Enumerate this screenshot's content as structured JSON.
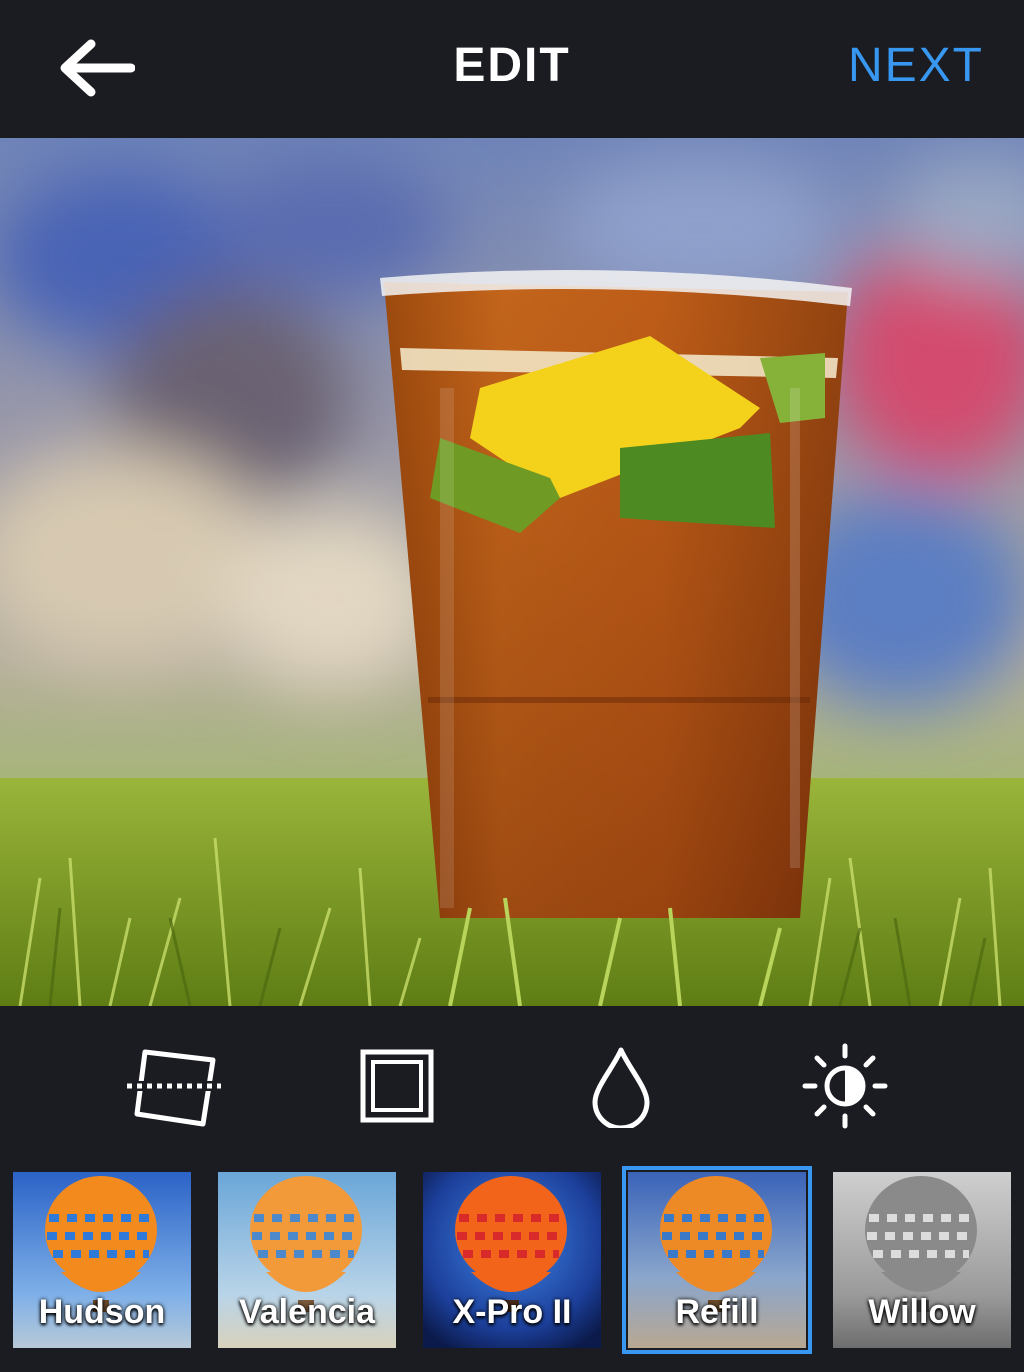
{
  "header": {
    "title": "EDIT",
    "next_label": "NEXT",
    "back_icon": "arrow-left-icon"
  },
  "colors": {
    "background": "#1a1c22",
    "accent": "#3897f0",
    "text": "#ffffff"
  },
  "photo": {
    "subject": "iced-drink-in-plastic-cup-on-grass"
  },
  "tools": [
    {
      "icon": "straighten-icon"
    },
    {
      "icon": "frame-icon"
    },
    {
      "icon": "tilt-shift-drop-icon"
    },
    {
      "icon": "lux-brightness-icon"
    }
  ],
  "filters": {
    "selected": "Refill",
    "items": [
      {
        "label": "Hudson"
      },
      {
        "label": "Valencia"
      },
      {
        "label": "X-Pro II"
      },
      {
        "label": "Refill"
      },
      {
        "label": "Willow"
      }
    ]
  }
}
